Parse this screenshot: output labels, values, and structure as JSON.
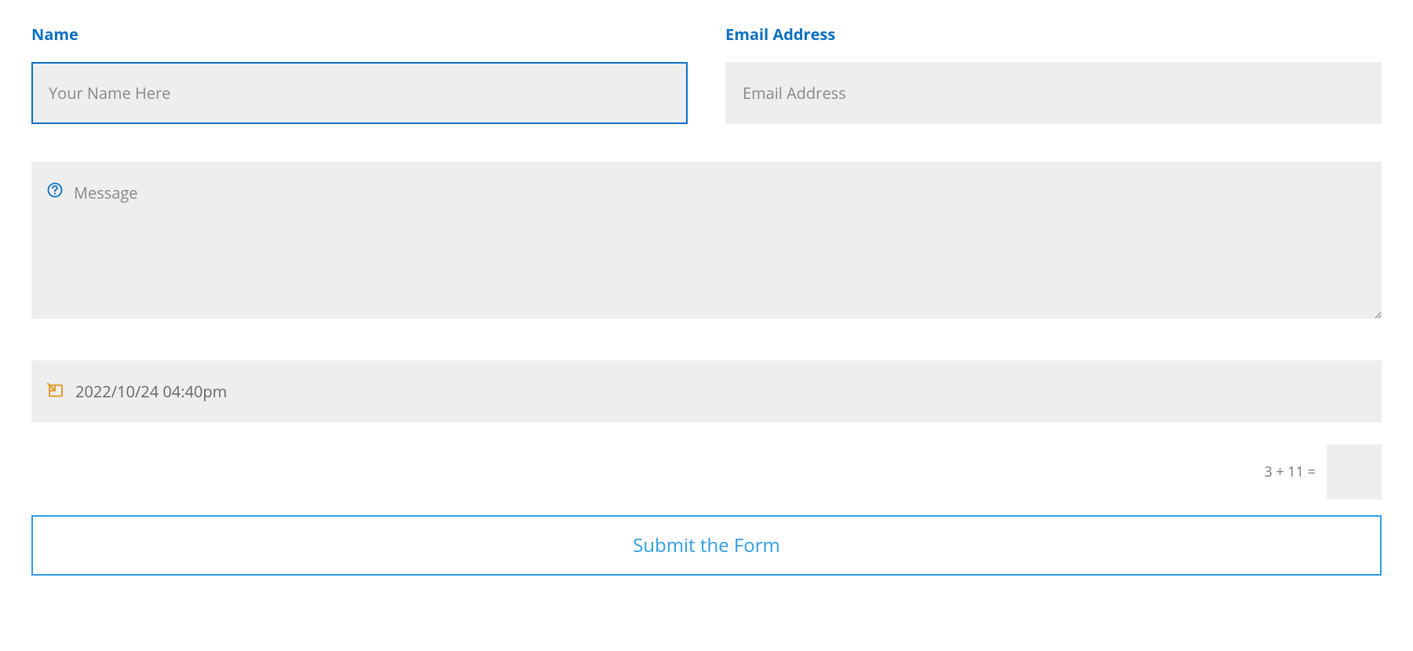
{
  "form": {
    "name": {
      "label": "Name",
      "placeholder": "Your Name Here",
      "value": ""
    },
    "email": {
      "label": "Email Address",
      "placeholder": "Email Address",
      "value": ""
    },
    "message": {
      "placeholder": "Message",
      "value": ""
    },
    "datetime": {
      "value": "2022/10/24 04:40pm"
    },
    "captcha": {
      "question": "3 + 11 =",
      "answer": ""
    },
    "submit_label": "Submit the Form"
  }
}
